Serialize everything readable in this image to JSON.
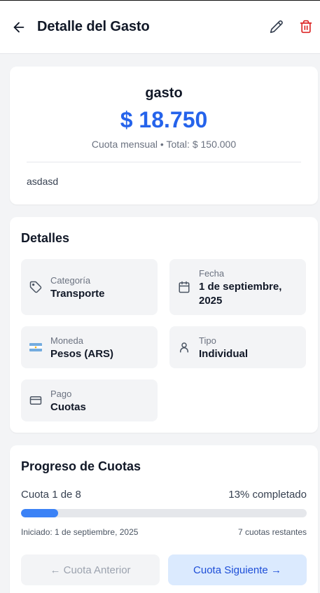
{
  "header": {
    "title": "Detalle del Gasto",
    "back_icon": "arrow-left-icon",
    "edit_icon": "pencil-icon",
    "delete_icon": "trash-icon",
    "delete_color": "#dc2626"
  },
  "summary": {
    "name": "gasto",
    "amount": "$ 18.750",
    "subtitle": "Cuota mensual • Total: $ 150.000",
    "description": "asdasd",
    "amount_color": "#2563eb"
  },
  "details": {
    "title": "Detalles",
    "items": [
      {
        "icon": "tag-icon",
        "label": "Categoría",
        "value": "Transporte"
      },
      {
        "icon": "calendar-icon",
        "label": "Fecha",
        "value": "1 de septiembre, 2025"
      },
      {
        "icon": "argentina-flag-icon",
        "label": "Moneda",
        "value": "Pesos (ARS)"
      },
      {
        "icon": "user-icon",
        "label": "Tipo",
        "value": "Individual"
      },
      {
        "icon": "credit-card-icon",
        "label": "Pago",
        "value": "Cuotas"
      }
    ]
  },
  "progress": {
    "title": "Progreso de Cuotas",
    "status_text": "Cuota 1 de 8",
    "percent_text": "13% completado",
    "percent_value": 13,
    "started_text": "Iniciado: 1 de septiembre, 2025",
    "remaining_text": "7 cuotas restantes",
    "prev_button": "← Cuota Anterior",
    "next_button": "Cuota Siguiente →",
    "bar_color": "#3b82f6"
  }
}
